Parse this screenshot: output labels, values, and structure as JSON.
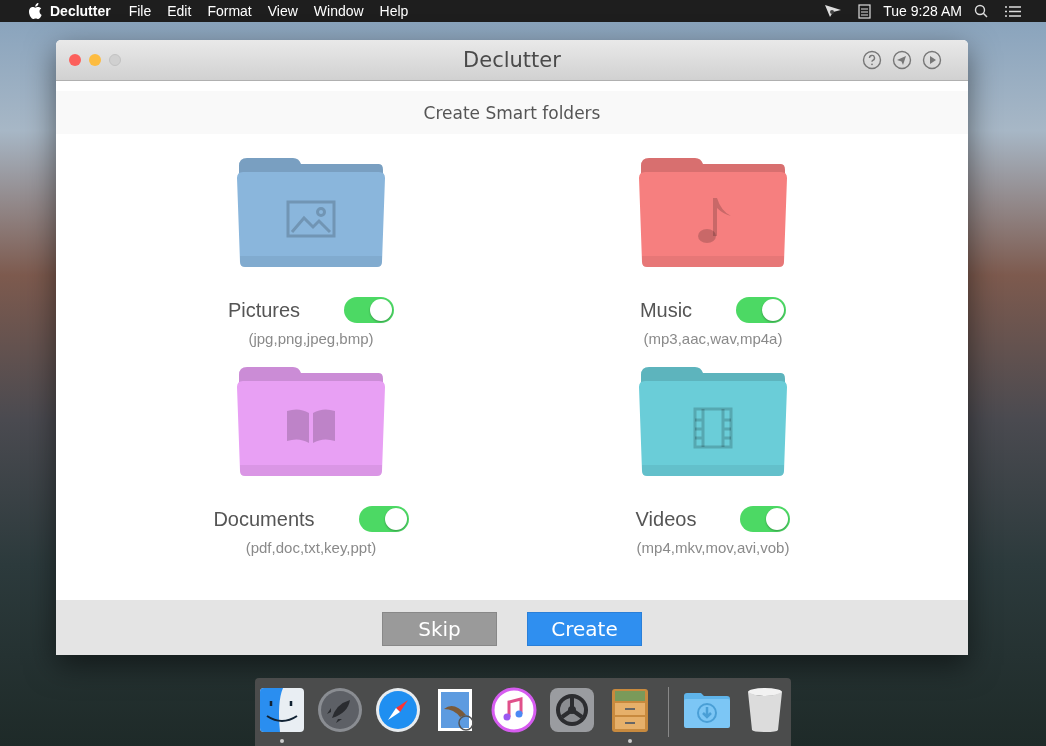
{
  "menu_bar": {
    "app_name": "Declutter",
    "menus": [
      "File",
      "Edit",
      "Format",
      "View",
      "Window",
      "Help"
    ],
    "clock": "Tue 9:28 AM"
  },
  "window": {
    "title": "Declutter",
    "subtitle": "Create Smart folders"
  },
  "folders": [
    {
      "kind": "pictures",
      "label": "Pictures",
      "extensions": "(jpg,png,jpeg,bmp)",
      "color": "#8ab6dc",
      "on": true
    },
    {
      "kind": "music",
      "label": "Music",
      "extensions": "(mp3,aac,wav,mp4a)",
      "color": "#f67f7f",
      "on": true
    },
    {
      "kind": "documents",
      "label": "Documents",
      "extensions": "(pdf,doc,txt,key,ppt)",
      "color": "#e8a0f4",
      "on": true
    },
    {
      "kind": "videos",
      "label": "Videos",
      "extensions": "(mp4,mkv,mov,avi,vob)",
      "color": "#6acdd8",
      "on": true
    }
  ],
  "buttons": [
    {
      "kind": "secondary",
      "label": "Skip"
    },
    {
      "kind": "primary",
      "label": "Create"
    }
  ],
  "dock": [
    {
      "kind": "finder",
      "running": true
    },
    {
      "kind": "launchpad",
      "running": false
    },
    {
      "kind": "safari",
      "running": false
    },
    {
      "kind": "mail",
      "running": false
    },
    {
      "kind": "itunes",
      "running": false
    },
    {
      "kind": "preferences",
      "running": false
    },
    {
      "kind": "declutter",
      "running": true
    },
    {
      "kind": "separator"
    },
    {
      "kind": "downloads",
      "running": false
    },
    {
      "kind": "trash",
      "running": false
    }
  ]
}
